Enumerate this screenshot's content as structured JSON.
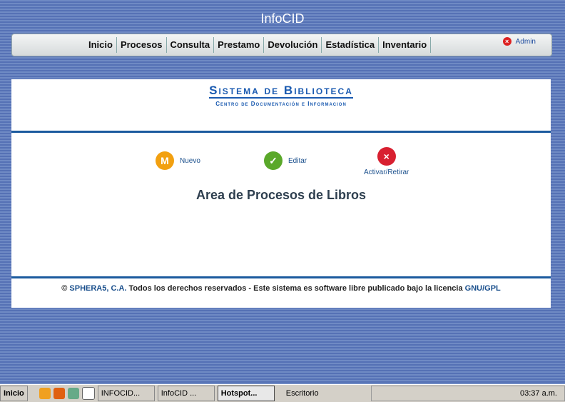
{
  "header": {
    "title": "InfoCID",
    "menu": [
      "Inicio",
      "Procesos",
      "Consulta",
      "Prestamo",
      "Devolución",
      "Estadística",
      "Inventario"
    ],
    "admin": "Admin"
  },
  "logo": {
    "title": "Sistema de Biblioteca",
    "subtitle": "Centro de Documentación e Informacion"
  },
  "actions": {
    "new": "Nuevo",
    "edit": "Editar",
    "toggle": "Activar/Retirar"
  },
  "main": {
    "heading": "Area de Procesos de Libros"
  },
  "footer": {
    "copy": "©",
    "company": "SPHERA5, C.A.",
    "text": " Todos los derechos reservados - Este sistema es software libre publicado bajo la licencia ",
    "license": "GNU/GPL"
  },
  "taskbar": {
    "start": "Inicio",
    "tasks": [
      "INFOCID...",
      "InfoCID ...",
      "Hotspot..."
    ],
    "desktop": "Escritorio",
    "clock": "03:37 a.m."
  }
}
